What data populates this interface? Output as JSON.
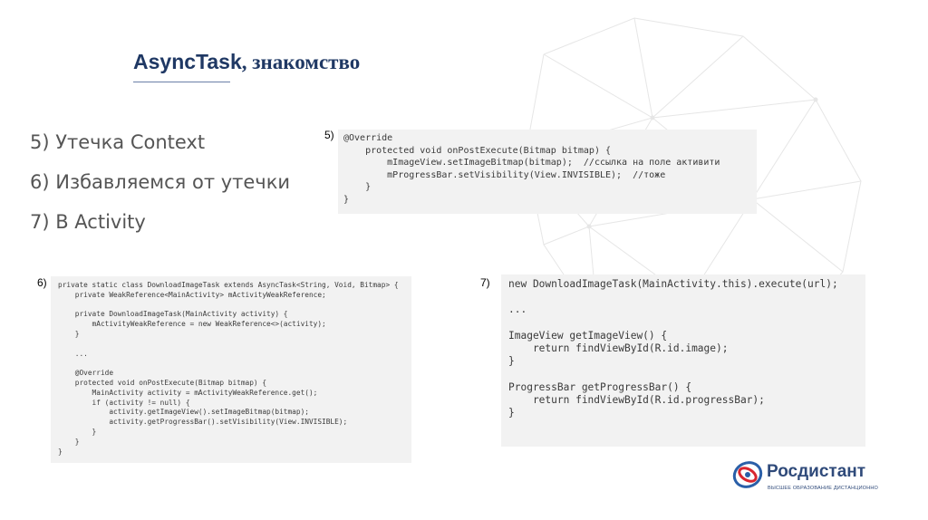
{
  "slide": {
    "title_part1": "AsyncTask",
    "title_part2": ", знакомство",
    "bullets": [
      "5) Утечка Context",
      "6) Избавляемся от утечки",
      "7) В Activity"
    ]
  },
  "snippets": {
    "s5": {
      "label": "5)",
      "lines": [
        "@Override",
        "    protected void onPostExecute(Bitmap bitmap) {",
        "        mImageView.setImageBitmap(bitmap);  //ссылка на поле активити",
        "        mProgressBar.setVisibility(View.INVISIBLE);  //тоже",
        "    }",
        "}"
      ]
    },
    "s6": {
      "label": "6)",
      "lines": [
        "private static class DownloadImageTask extends AsyncTask<String, Void, Bitmap> {",
        "    private WeakReference<MainActivity> mActivityWeakReference;",
        "",
        "    private DownloadImageTask(MainActivity activity) {",
        "        mActivityWeakReference = new WeakReference<>(activity);",
        "    }",
        "",
        "    ...",
        "",
        "    @Override",
        "    protected void onPostExecute(Bitmap bitmap) {",
        "        MainActivity activity = mActivityWeakReference.get();",
        "        if (activity != null) {",
        "            activity.getImageView().setImageBitmap(bitmap);",
        "            activity.getProgressBar().setVisibility(View.INVISIBLE);",
        "        }",
        "    }",
        "}"
      ]
    },
    "s7": {
      "label": "7)",
      "lines": [
        "new DownloadImageTask(MainActivity.this).execute(url);",
        "",
        "...",
        "",
        "ImageView getImageView() {",
        "    return findViewById(R.id.image);",
        "}",
        "",
        "ProgressBar getProgressBar() {",
        "    return findViewById(R.id.progressBar);",
        "}"
      ]
    }
  },
  "branding": {
    "name": "Росдистант",
    "tagline": "ВЫСШЕЕ ОБРАЗОВАНИЕ ДИСТАНЦИОННО",
    "colors": {
      "title": "#1f3864",
      "brand": "#2f4a7a",
      "logo_red": "#d8262f",
      "logo_blue": "#2a5fa8"
    }
  }
}
